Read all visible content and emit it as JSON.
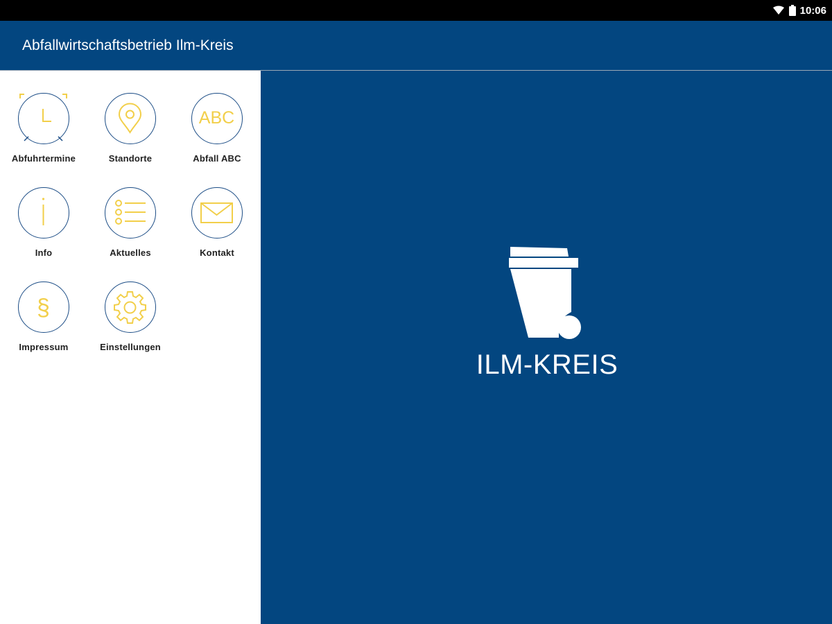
{
  "status_bar": {
    "time": "10:06",
    "icons": [
      "wifi-icon",
      "battery-icon"
    ]
  },
  "app_bar": {
    "title": "Abfallwirtschaftsbetrieb Ilm-Kreis"
  },
  "menu": {
    "items": [
      {
        "label": "Abfuhrtermine",
        "icon": "alarm-clock-icon"
      },
      {
        "label": "Standorte",
        "icon": "location-pin-icon"
      },
      {
        "label": "Abfall ABC",
        "icon": "abc-icon",
        "icon_text": "ABC"
      },
      {
        "label": "Info",
        "icon": "info-icon"
      },
      {
        "label": "Aktuelles",
        "icon": "list-icon"
      },
      {
        "label": "Kontakt",
        "icon": "envelope-icon"
      },
      {
        "label": "Impressum",
        "icon": "paragraph-icon",
        "icon_text": "§"
      },
      {
        "label": "Einstellungen",
        "icon": "gear-icon"
      }
    ]
  },
  "logo": {
    "text": "ILM-KREIS",
    "icon": "waste-bin-icon"
  },
  "colors": {
    "primary": "#034680",
    "icon_accent": "#f2cf4a",
    "circle_border": "#1c4d86",
    "label_text": "#222222"
  }
}
